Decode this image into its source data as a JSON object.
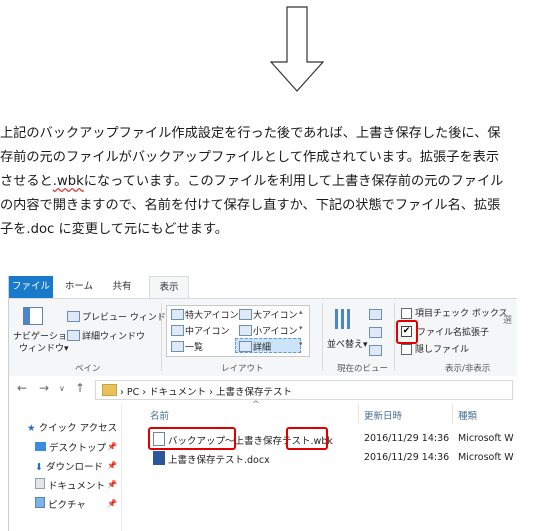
{
  "paragraph": {
    "lines": [
      "上記のバックアップファイル作成設定を行った後であれば、上書き保存した後に、保",
      "存前の元のファイルがバックアップファイルとして作成されています。拡張子を表示",
      "させると",
      "になっています。このファイルを利用して上書き保存前の元のファイル",
      "の内容で開きますので、名前を付けて保存し直すか、下記の状態でファイル名、拡張",
      "子を.doc に変更して元にもどせます。"
    ],
    "wbk": ".wbk"
  },
  "tabs": {
    "file": "ファイル",
    "home": "ホーム",
    "share": "共有",
    "view": "表示"
  },
  "ribbon": {
    "nav_pane_line1": "ナビゲーション",
    "nav_pane_line2": "ウィンドウ",
    "preview_pane": "プレビュー ウィンドウ",
    "details_pane": "詳細ウィンドウ",
    "group_pane": "ペイン",
    "layout": {
      "extra_large": "特大アイコン",
      "large": "大アイコン",
      "medium": "中アイコン",
      "small": "小アイコン",
      "list": "一覧",
      "details": "詳細"
    },
    "group_layout": "レイアウト",
    "sort_by": "並べ替え",
    "group_current_view": "現在のビュー",
    "item_checkbox": "項目チェック ボックス",
    "file_ext": "ファイル名拡張子",
    "hidden_files": "隠しファイル",
    "group_show_hide": "表示/非表示",
    "cut_label": "選"
  },
  "address": {
    "pc": "PC",
    "documents": "ドキュメント",
    "folder": "上書き保存テスト"
  },
  "nav_pane": {
    "items": [
      {
        "label": "クイック アクセス"
      },
      {
        "label": "デスクトップ"
      },
      {
        "label": "ダウンロード"
      },
      {
        "label": "ドキュメント"
      },
      {
        "label": "ピクチャ"
      }
    ]
  },
  "file_list": {
    "headers": {
      "name": "名前",
      "modified": "更新日時",
      "type": "種類"
    },
    "rows": [
      {
        "name_part1": "バックアップ～",
        "name_part2": "上書き保存テスト",
        "name_ext": ".wbk",
        "modified": "2016/11/29 14:36",
        "type": "Microsoft W"
      },
      {
        "name": "上書き保存テスト.docx",
        "modified": "2016/11/29 14:36",
        "type": "Microsoft W"
      }
    ]
  },
  "colors": {
    "file_tab": "#1979ca",
    "highlight": "#e00000",
    "folder": "#e8c15a"
  }
}
